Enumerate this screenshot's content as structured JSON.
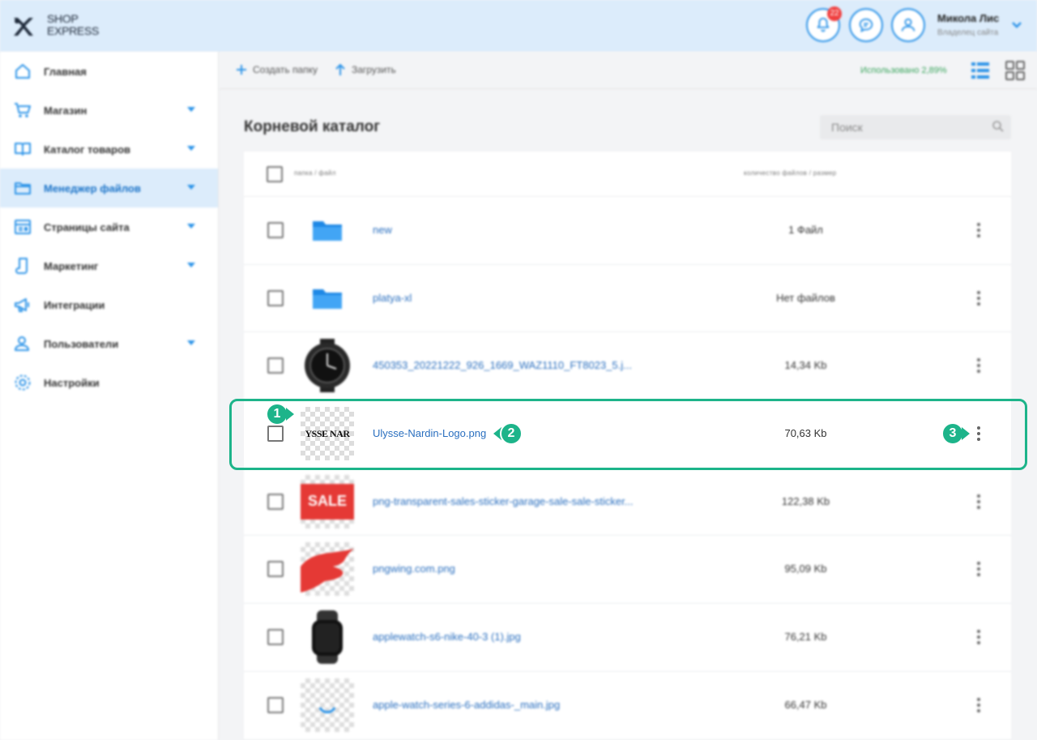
{
  "header": {
    "logo_line1": "SHOP",
    "logo_line2": "EXPRESS",
    "notifications_count": "22",
    "user_name": "Микола Лис",
    "user_role": "Владелец сайта"
  },
  "sidebar": {
    "items": [
      {
        "label": "Главная",
        "icon": "home-icon",
        "has_caret": false,
        "active": false
      },
      {
        "label": "Магазин",
        "icon": "cart-icon",
        "has_caret": true,
        "active": false
      },
      {
        "label": "Каталог товаров",
        "icon": "book-icon",
        "has_caret": true,
        "active": false
      },
      {
        "label": "Менеджер файлов",
        "icon": "folder-icon",
        "has_caret": true,
        "active": true
      },
      {
        "label": "Страницы сайта",
        "icon": "pages-icon",
        "has_caret": true,
        "active": false
      },
      {
        "label": "Маркетинг",
        "icon": "marketing-icon",
        "has_caret": true,
        "active": false
      },
      {
        "label": "Интеграции",
        "icon": "megaphone-icon",
        "has_caret": false,
        "active": false
      },
      {
        "label": "Пользователи",
        "icon": "users-icon",
        "has_caret": true,
        "active": false
      },
      {
        "label": "Настройки",
        "icon": "gear-icon",
        "has_caret": false,
        "active": false
      }
    ]
  },
  "toolbar": {
    "create_folder": "Создать папку",
    "upload": "Загрузить",
    "usage": "Использовано 2,89%"
  },
  "main": {
    "title": "Корневой каталог",
    "search_placeholder": "Поиск",
    "columns": {
      "name": "папка / файл",
      "size": "количество файлов / размер"
    },
    "rows": [
      {
        "name": "new",
        "size": "1 Файл",
        "type": "folder",
        "thumb": "folder"
      },
      {
        "name": "platya-xl",
        "size": "Нет файлов",
        "type": "folder",
        "thumb": "folder"
      },
      {
        "name": "450353_20221222_926_1669_WAZ1110_FT8023_5.j...",
        "size": "14,34 Kb",
        "type": "image",
        "thumb": "watch"
      },
      {
        "name": "Ulysse-Nardin-Logo.png",
        "size": "70,63 Kb",
        "type": "image",
        "thumb": "logo",
        "thumb_text": "YSSE NAR"
      },
      {
        "name": "png-transparent-sales-sticker-garage-sale-sale-sticker...",
        "size": "122,38 Kb",
        "type": "image",
        "thumb": "sale",
        "thumb_text": "SALE"
      },
      {
        "name": "pngwing.com.png",
        "size": "95,09 Kb",
        "type": "image",
        "thumb": "red-splash"
      },
      {
        "name": "applewatch-s6-nike-40-3 (1).jpg",
        "size": "76,21 Kb",
        "type": "image",
        "thumb": "applewatch"
      },
      {
        "name": "apple-watch-series-6-addidas-_main.jpg",
        "size": "66,47 Kb",
        "type": "image",
        "thumb": "loading"
      }
    ]
  },
  "callouts": [
    "1",
    "2",
    "3"
  ],
  "colors": {
    "accent": "#2b93e8",
    "header_bg": "#dcecfb",
    "highlight": "#1db48a",
    "link": "#2a6fbf",
    "usage": "#3aa55d",
    "badge": "#f04040"
  }
}
